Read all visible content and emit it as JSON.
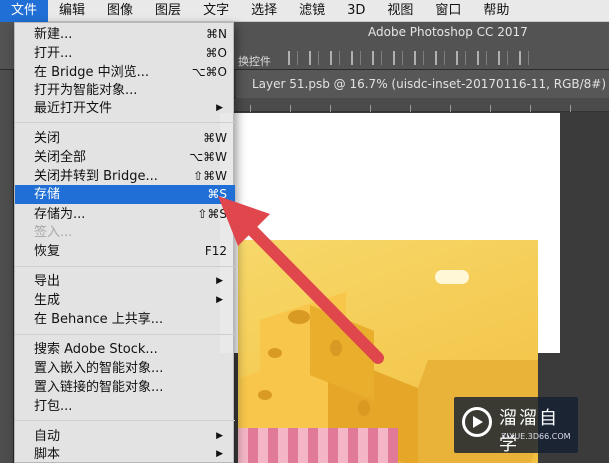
{
  "menubar": {
    "items": [
      "文件",
      "编辑",
      "图像",
      "图层",
      "文字",
      "选择",
      "滤镜",
      "3D",
      "视图",
      "窗口",
      "帮助"
    ]
  },
  "app": {
    "title": "Adobe Photoshop CC 2017",
    "options_label": "换控件",
    "tab_title": "Layer 51.psb @ 16.7% (uisdc-inset-20170116-11, RGB/8#)"
  },
  "file_menu": {
    "items": [
      {
        "label": "新建...",
        "shortcut": "⌘N"
      },
      {
        "label": "打开...",
        "shortcut": "⌘O"
      },
      {
        "label": "在 Bridge 中浏览...",
        "shortcut": "⌥⌘O"
      },
      {
        "label": "打开为智能对象...",
        "shortcut": ""
      },
      {
        "label": "最近打开文件",
        "shortcut": "▶"
      },
      {
        "label": "关闭",
        "shortcut": "⌘W"
      },
      {
        "label": "关闭全部",
        "shortcut": "⌥⌘W"
      },
      {
        "label": "关闭并转到 Bridge...",
        "shortcut": "⇧⌘W"
      },
      {
        "label": "存储",
        "shortcut": "⌘S"
      },
      {
        "label": "存储为...",
        "shortcut": "⇧⌘S"
      },
      {
        "label": "签入...",
        "shortcut": ""
      },
      {
        "label": "恢复",
        "shortcut": "F12"
      },
      {
        "label": "导出",
        "shortcut": "▶"
      },
      {
        "label": "生成",
        "shortcut": "▶"
      },
      {
        "label": "在 Behance 上共享...",
        "shortcut": ""
      },
      {
        "label": "搜索 Adobe Stock...",
        "shortcut": ""
      },
      {
        "label": "置入嵌入的智能对象...",
        "shortcut": ""
      },
      {
        "label": "置入链接的智能对象...",
        "shortcut": ""
      },
      {
        "label": "打包...",
        "shortcut": ""
      },
      {
        "label": "自动",
        "shortcut": "▶"
      },
      {
        "label": "脚本",
        "shortcut": "▶"
      }
    ]
  },
  "watermark": {
    "name": "溜溜自学",
    "url": "ZIXUE.3D66.COM"
  },
  "colors": {
    "highlight": "#1f6fd6",
    "arrow": "#e0474c"
  }
}
